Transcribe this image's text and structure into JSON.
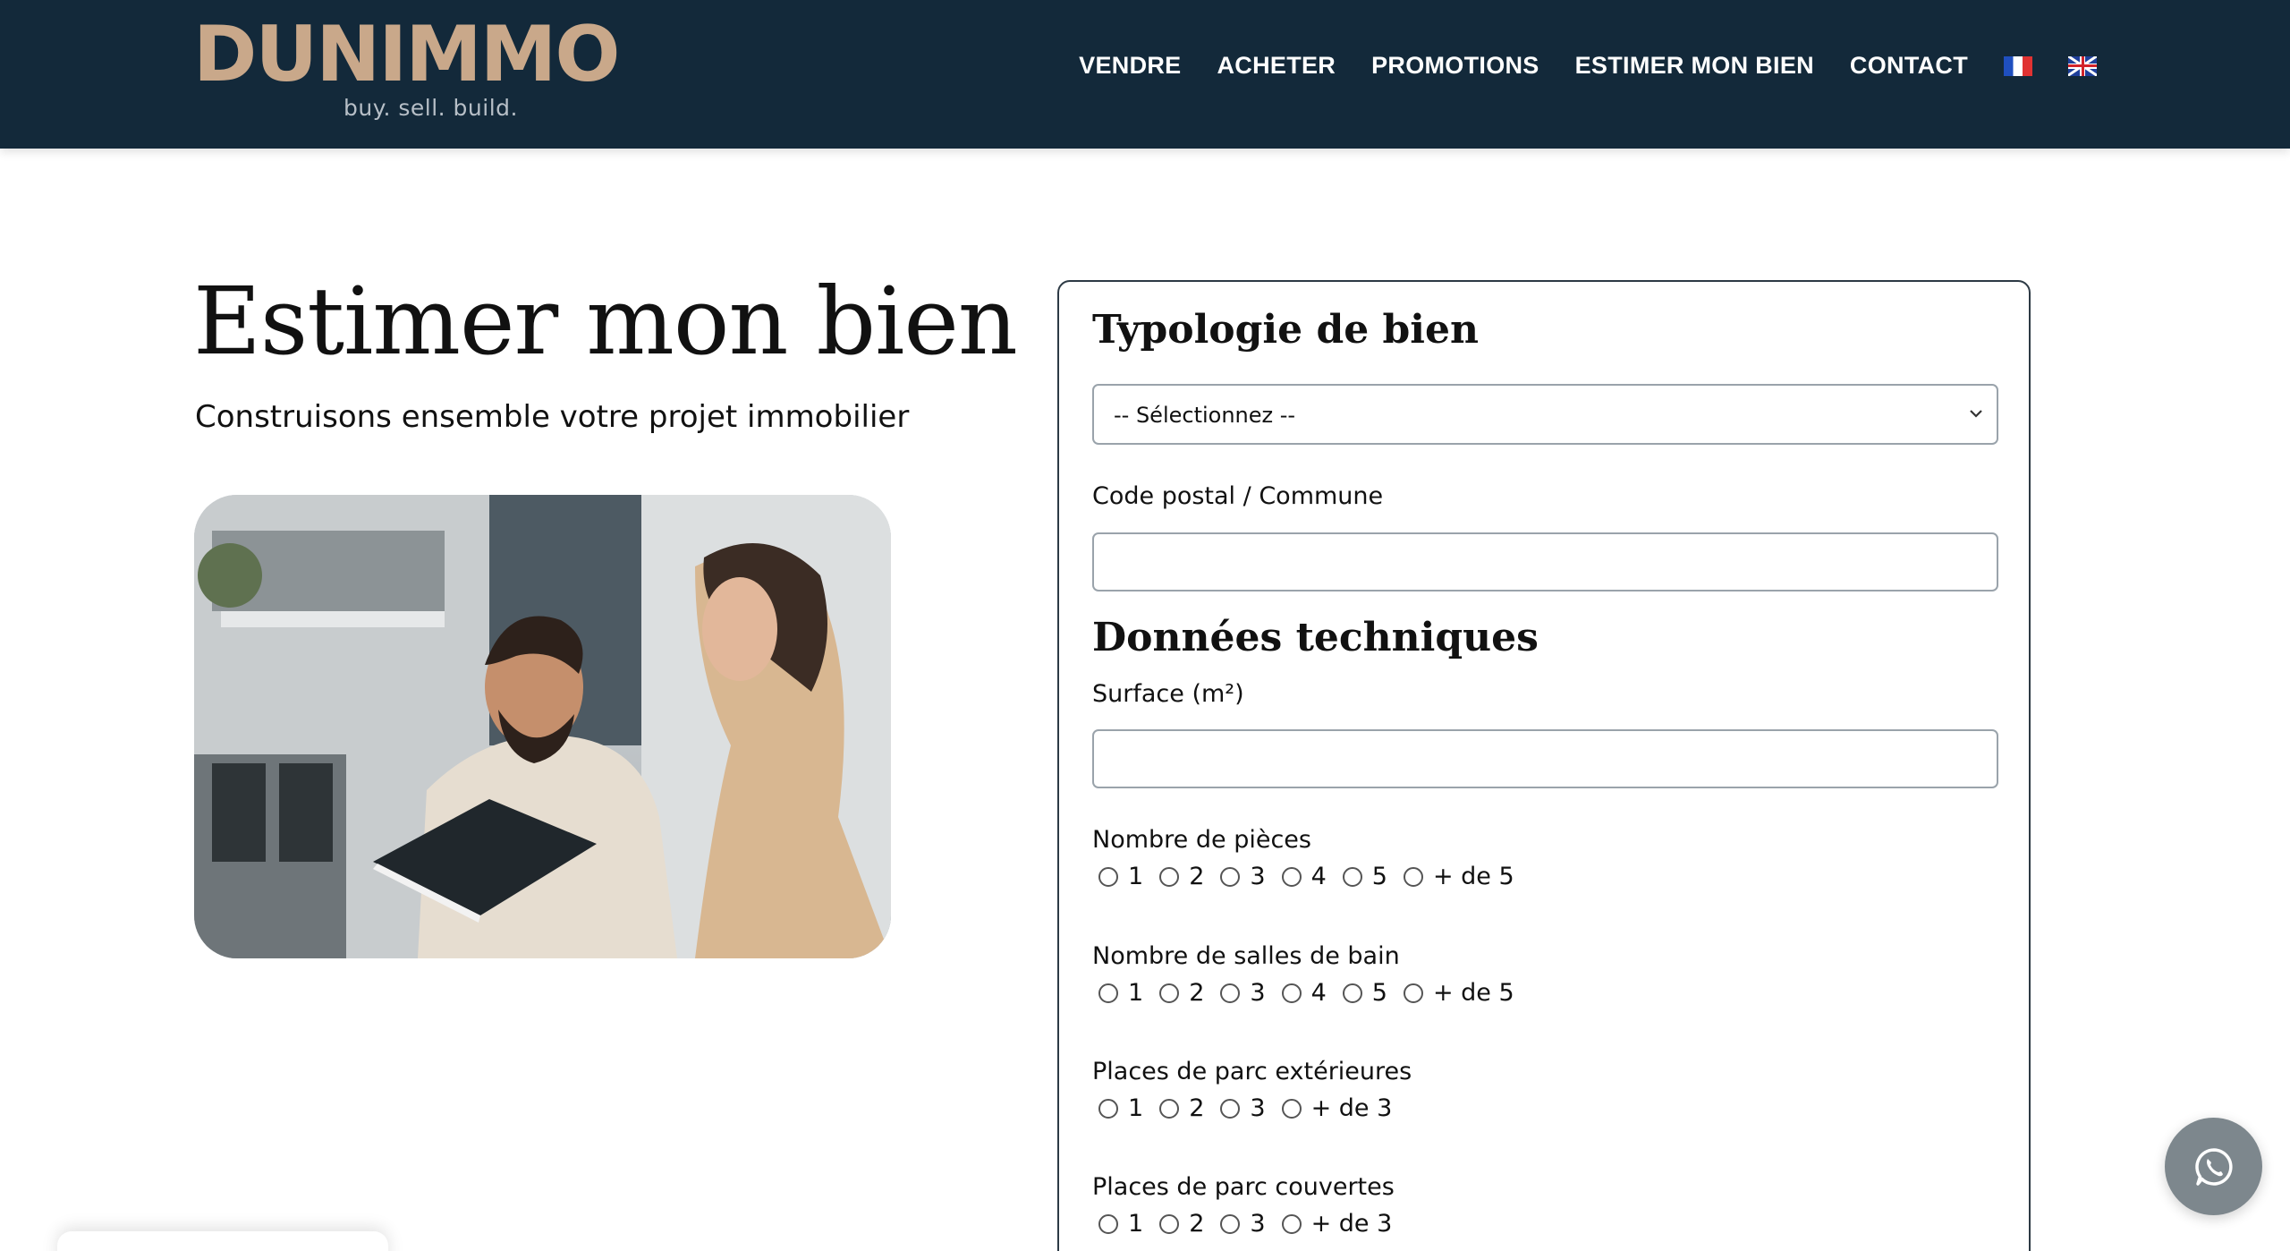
{
  "header": {
    "logo_text": "DUNIMMO",
    "logo_tagline": "buy. sell. build.",
    "nav": [
      "VENDRE",
      "ACHETER",
      "PROMOTIONS",
      "ESTIMER MON BIEN",
      "CONTACT"
    ],
    "languages": [
      "fr-flag-icon",
      "uk-flag-icon"
    ]
  },
  "intro": {
    "title": "Estimer mon bien",
    "subtitle": "Construisons ensemble votre projet immobilier"
  },
  "form": {
    "typologie": {
      "title": "Typologie de bien",
      "select_value": "-- Sélectionnez --"
    },
    "code_postal": {
      "label": "Code postal / Commune",
      "value": ""
    },
    "donnees": {
      "title": "Données techniques"
    },
    "surface": {
      "label": "Surface (m²)",
      "value": ""
    },
    "pieces": {
      "label": "Nombre de pièces",
      "options": [
        "1",
        "2",
        "3",
        "4",
        "5",
        "+ de 5"
      ]
    },
    "salles_bain": {
      "label": "Nombre de salles de bain",
      "options": [
        "1",
        "2",
        "3",
        "4",
        "5",
        "+ de 5"
      ]
    },
    "parc_ext": {
      "label": "Places de parc extérieures",
      "options": [
        "1",
        "2",
        "3",
        "+ de 3"
      ]
    },
    "parc_couv": {
      "label": "Places de parc couvertes",
      "options": [
        "1",
        "2",
        "3",
        "+ de 3"
      ]
    }
  },
  "colors": {
    "header_bg": "#13293a",
    "logo_gold": "#c9a88a",
    "whatsapp_bg": "#7d878d"
  }
}
